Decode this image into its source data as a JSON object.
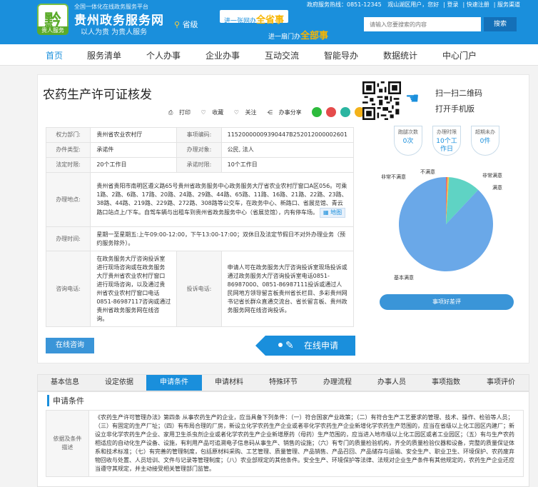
{
  "header": {
    "logo_char": "黔",
    "logo_tag": "贵人服务",
    "site_subtitle": "全国一体化在线政务服务平台",
    "site_title": "贵州政务服务网",
    "site_slogan": "以人为贵 为贵人服务",
    "region": "省级",
    "slogan1_prefix": "进一张网办",
    "slogan1_bold": "全省事",
    "slogan2_prefix": "进一扇门办",
    "slogan2_bold": "全部事",
    "hotline": "政府服务热线：0851-12345",
    "user_greeting": "观山湖区用户，您好",
    "login": "登录",
    "quick_register": "快速注册",
    "service_channel": "服务渠道",
    "search_placeholder": "请输入您要搜索的内容",
    "search_button": "搜索"
  },
  "nav": {
    "items": [
      "首页",
      "服务清单",
      "个人办事",
      "企业办事",
      "互动交流",
      "智能导办",
      "数据统计",
      "中心门户"
    ]
  },
  "item": {
    "title": "农药生产许可证核发",
    "share": {
      "print": "打印",
      "favorite": "收藏",
      "follow": "关注",
      "share_label": "办事分享"
    }
  },
  "info": {
    "authority_label": "权力部门:",
    "authority": "贵州省农业农村厅",
    "code_label": "事项编码:",
    "code": "11520000009390447B252012000002601",
    "type_label": "办件类型:",
    "type": "承诺件",
    "target_label": "办理对象:",
    "target": "公民, 法人",
    "legal_label": "法定时限:",
    "legal": "20个工作日",
    "promise_label": "承诺时限:",
    "promise": "10个工作日",
    "location_label": "办理地点:",
    "location": "贵州省贵阳市南明区遵义路65号贵州省政务服务中心政务服务大厅省农业农村厅窗口A区056。可乘1路、2路、6路、17路、20路、24路、29路、44路、65路、11路、16路、21路、22路、23路、38路、44路、219路、229路、272路、308路等公交车，在政务中心、新路口、省展览馆、青云路口站点上/下车。自驾车辆与出租车到贵州省政务服务中心（省展览馆），内有停车场。",
    "map_link": "地图",
    "hours_label": "办理时间:",
    "hours": "星期一至星期五:上午09:00-12:00，下午13:00-17:00；双休日及法定节假日不对外办理业务（预约服务除外）。",
    "consult_label": "咨询电话:",
    "consult": "在政务服务大厅咨询投诉室进行现场咨询或在政务服务大厅贵州省农业农村厅窗口进行现场咨询，以及通过贵州省农业农村厅窗口电话0851-86987117咨询或通过贵州省政务服务网在线咨询。",
    "complaint_label": "投诉电话:",
    "complaint": "申请人可在政务服务大厅咨询投诉室现场投诉或通过政务服务大厅咨询投诉室电话0851-86987000、0851-86987111投诉或通过人民网地方领导留言板贵州省长栏目、多彩贵州网书记省长群众直通交流台、省长留言板、贵州政务服务网在线咨询投诉。"
  },
  "actions": {
    "consult_button": "在线咨询",
    "apply_button": "在线申请"
  },
  "qr": {
    "line1": "扫一扫二维码",
    "line2": "打开手机版"
  },
  "stats": [
    {
      "label": "跑腿次数",
      "value": "0次"
    },
    {
      "label": "办理时限",
      "value": "10个工作日"
    },
    {
      "label": "超期未办",
      "value": "0件"
    }
  ],
  "satisfaction": {
    "labels": [
      "非常不满意",
      "不满意",
      "非常满意",
      "满意",
      "基本满意"
    ],
    "slices": [
      {
        "name": "满意",
        "value": 88,
        "color": "#6aa8e8"
      },
      {
        "name": "非常满意",
        "value": 11,
        "color": "#5fd3c4"
      },
      {
        "name": "不满意",
        "value": 0.5,
        "color": "#f5c842"
      },
      {
        "name": "非常不满意",
        "value": 0.5,
        "color": "#e86a6a"
      }
    ],
    "rate_button": "事项好差评"
  },
  "tabs": {
    "items": [
      "基本信息",
      "设定依据",
      "申请条件",
      "申请材料",
      "特殊环节",
      "办理流程",
      "办事人员",
      "事项指数",
      "事项评价"
    ],
    "active_index": 2
  },
  "condition": {
    "heading": "申请条件",
    "label": "依据及条件描述",
    "text": "《农药生产许可管理办法》第四条 从事农药生产的企业，应当具备下列条件：（一）符合国家产业政策；（二）有符合生产工艺要求的管理、技术、操作、检验等人员；（三）有固定的生产厂址；（四）有布局合理的厂房，新设立化学农药生产企业或者非化学农药生产企业新增化学农药生产范围的，应当在省级以上化工园区内建厂；新设立非化学农药生产企业、家用卫生杀虫剂企业或者化学农药生产企业新增原药（母药）生产范围的，应当进入地市级以上化工园区或者工业园区；（五）有与生产农药相适应的自动化生产设备、设施，有利用产品可追溯电子信息码从事生产、销售的设施；（六）有专门的质量检验机构，齐全的质量检验仪器和设备，完整的质量保证体系和技术标准；（七）有完善的管理制度，包括原材料采购、工艺管理、质量管理、产品销售、产品召回、产品储存与运输、安全生产、职业卫生、环境保护、农药废弃物回收与处置、人员培训、文件与记录等管理制度；（八）农业部规定的其他条件。安全生产、环境保护等法律、法规对企业生产条件有其他规定的，农药生产企业还应当遵守其规定，并主动接受相关管理部门监管。"
  }
}
